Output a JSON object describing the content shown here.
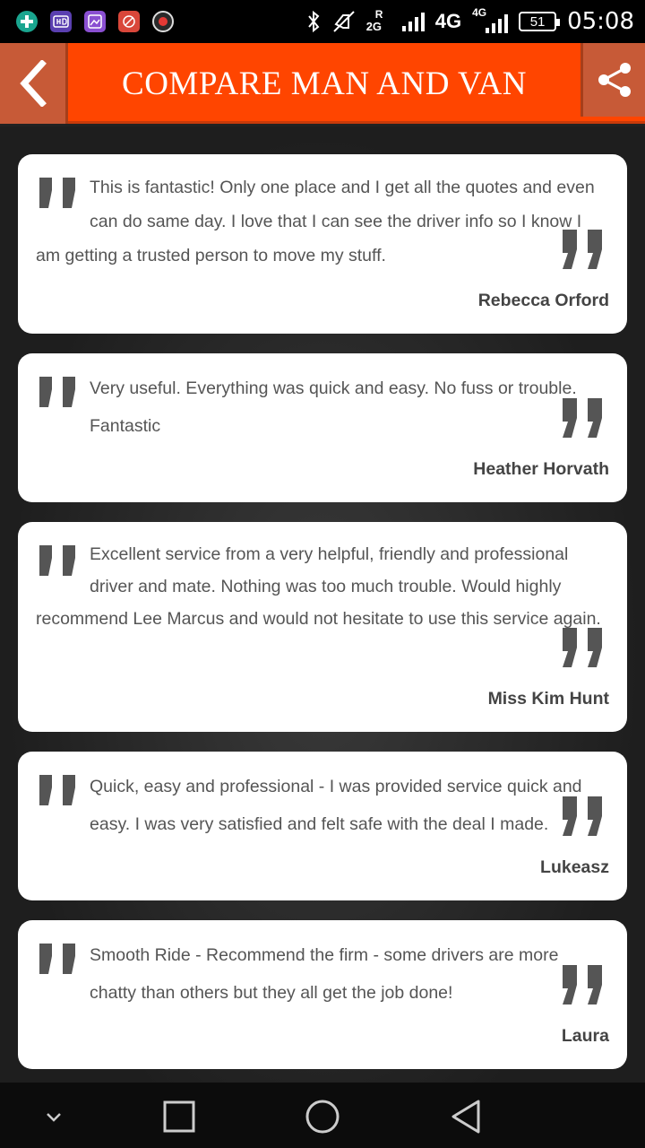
{
  "status_bar": {
    "notification_icons": [
      "plus-icon",
      "hd-icon",
      "gallery-icon",
      "tools-icon",
      "record-icon"
    ],
    "network_2g": "2G",
    "network_r": "R",
    "network_4g_a": "4G",
    "network_4g_b": "4G",
    "battery": "51",
    "time": "05:08"
  },
  "header": {
    "title": "COMPARE MAN AND VAN",
    "back_icon": "chevron-left-icon",
    "share_icon": "share-icon",
    "color": "#ff4500"
  },
  "reviews": [
    {
      "text": "This is fantastic! Only one place and I get all the quotes and even can do same day. I love that I can see the driver info so I know I am getting a trusted person to move my stuff.",
      "author": "Rebecca Orford"
    },
    {
      "text": "Very useful. Everything was quick and easy. No fuss or trouble. Fantastic",
      "author": "Heather Horvath"
    },
    {
      "text": "Excellent service from a very helpful, friendly and professional driver and mate. Nothing was too much trouble. Would highly recommend Lee Marcus and would not hesitate to use this service again.",
      "author": "Miss Kim Hunt"
    },
    {
      "text": "Quick, easy and professional - I was provided service quick and easy. I was very satisfied and felt safe with the deal I made.",
      "author": "Lukeasz"
    },
    {
      "text": "Smooth Ride - Recommend the firm - some drivers are more chatty than others but they all get the job done!",
      "author": "Laura"
    }
  ],
  "nav_bar": {
    "icons": [
      "chevron-down-icon",
      "recents-icon",
      "home-icon",
      "back-icon"
    ]
  }
}
